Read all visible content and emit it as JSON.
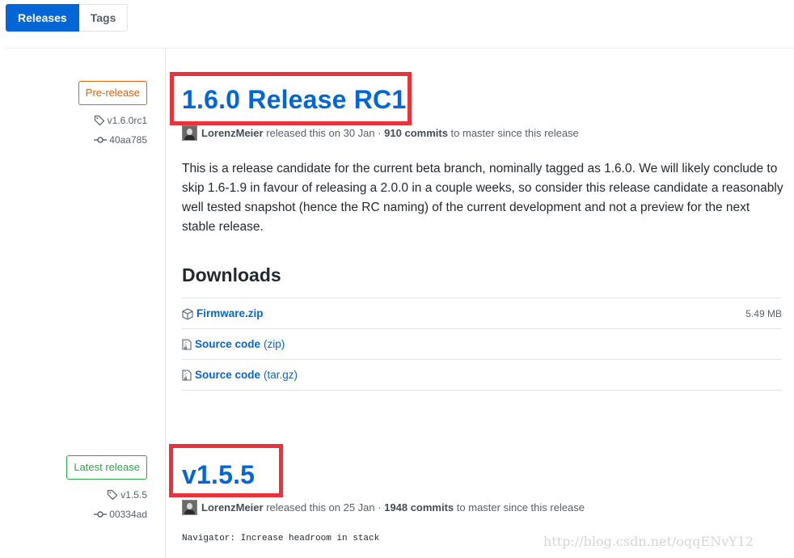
{
  "tabs": {
    "releases": "Releases",
    "tags": "Tags"
  },
  "releases": [
    {
      "badge": "Pre-release",
      "tag": "v1.6.0rc1",
      "commit": "40aa785",
      "title": "1.6.0 Release RC1",
      "author": "LorenzMeier",
      "released_text": " released this on 30 Jan · ",
      "commits": "910 commits",
      "since_text": " to master since this release",
      "description": "This is a release candidate for the current beta branch, nominally tagged as 1.6.0. We will likely conclude to skip 1.6-1.9 in favour of releasing a 2.0.0 in a couple weeks, so consider this release candidate a reasonably well tested snapshot (hence the RC naming) of the current development and not a preview for the next stable release.",
      "downloads_heading": "Downloads",
      "downloads": [
        {
          "name": "Firmware.zip",
          "suffix": "",
          "size": "5.49 MB",
          "icon": "package-icon"
        },
        {
          "name": "Source code",
          "suffix": "(zip)",
          "size": "",
          "icon": "file-zip-icon"
        },
        {
          "name": "Source code",
          "suffix": "(tar.gz)",
          "size": "",
          "icon": "file-zip-icon"
        }
      ]
    },
    {
      "badge": "Latest release",
      "tag": "v1.5.5",
      "commit": "00334ad",
      "title": "v1.5.5",
      "author": "LorenzMeier",
      "released_text": " released this on 25 Jan · ",
      "commits": "1948 commits",
      "since_text": " to master since this release",
      "commit_message": "Navigator: Increase headroom in stack"
    }
  ],
  "watermark": "http://blog.csdn.net/oqqENvY12",
  "colors": {
    "link": "#0366d6",
    "prerelease": "#e36209",
    "latest": "#28a745",
    "highlight": "#e8323c"
  }
}
